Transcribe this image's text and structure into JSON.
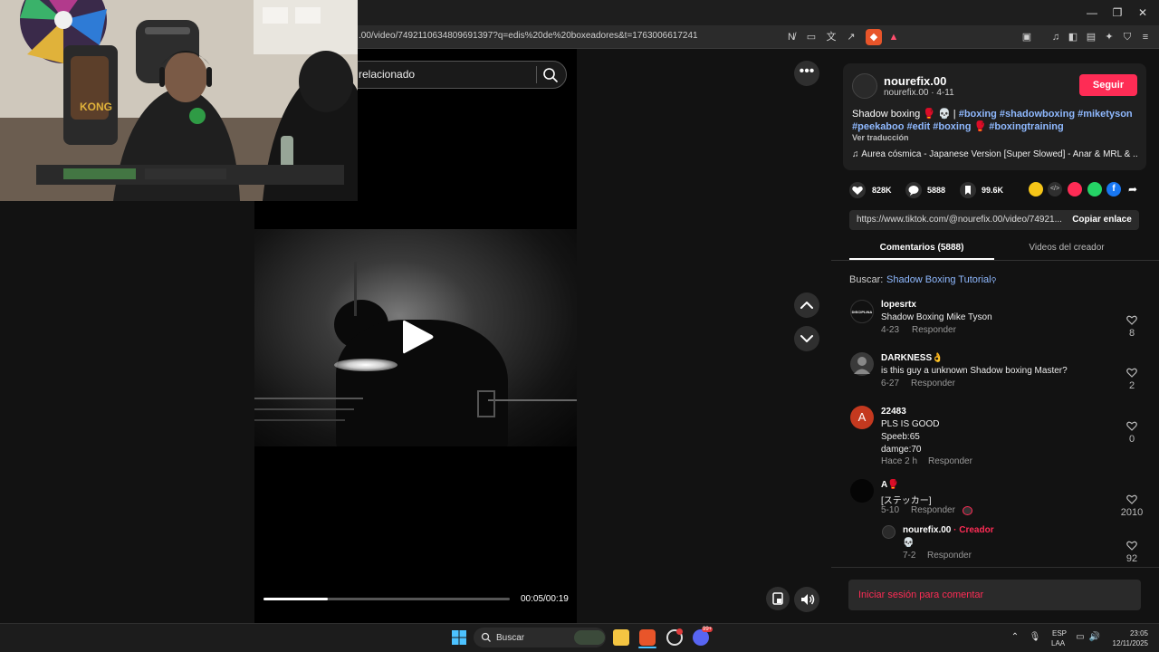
{
  "browser": {
    "url": ".00/video/7492110634809691397?q=edis%20de%20boxeadores&t=1763006617241"
  },
  "page": {
    "search_text": "relacionado",
    "time": "00:05/00:19",
    "progress_fraction": 0.26
  },
  "author": {
    "name": "nourefix.00",
    "sub": "nourefix.00 · 4-11",
    "follow": "Seguir"
  },
  "description": {
    "text": "Shadow boxing 🥊 💀 | ",
    "tags": "#boxing #shadowboxing #miketyson #peekaboo #edit #boxing 🥊 #boxingtraining",
    "translate": "Ver traducción",
    "music": "♫  Áurea cósmica - Japanese Version [Super Slowed] - Anar & MRL & ..."
  },
  "stats": {
    "likes": "828K",
    "comments": "5888",
    "saves": "99.6K"
  },
  "link": {
    "url": "https://www.tiktok.com/@nourefix.00/video/74921...",
    "copy": "Copiar enlace"
  },
  "tabs": {
    "comments": "Comentarios (5888)",
    "creator": "Videos del creador"
  },
  "search_suggestion": {
    "label": "Buscar:",
    "link": "Shadow Boxing Tutorial"
  },
  "comments": [
    {
      "user": "lopesrtx",
      "text": "Shadow Boxing Mike Tyson",
      "date": "4-23",
      "reply": "Responder",
      "likes": "8",
      "avatar_text": "DISCIPLINA"
    },
    {
      "user": "DARKNESS👌",
      "text": "is this guy a unknown Shadow boxing Master?",
      "date": "6-27",
      "reply": "Responder",
      "likes": "2"
    },
    {
      "user": "22483",
      "text": "PLS IS GOOD",
      "text2": "Speeb:65",
      "text3": "damge:70",
      "date": "Hace 2 h",
      "reply": "Responder",
      "likes": "0",
      "avatar_text": "A"
    },
    {
      "user": "A🥊",
      "text": "[ステッカー]",
      "date": "5-10",
      "reply": "Responder",
      "likes": "2010"
    },
    {
      "user": "nourefix.00",
      "creator_tag": "· Creador",
      "text": "💀",
      "date": "7-2",
      "reply": "Responder",
      "likes": "92"
    }
  ],
  "login": "Iniciar sesión para comentar",
  "taskbar": {
    "search": "Buscar",
    "lang1": "ESP",
    "lang2": "LAA",
    "time": "23:05",
    "date": "12/11/2025",
    "badge": "99+"
  },
  "colors": {
    "accent": "#fe2c55",
    "link": "#8fb9ff"
  }
}
